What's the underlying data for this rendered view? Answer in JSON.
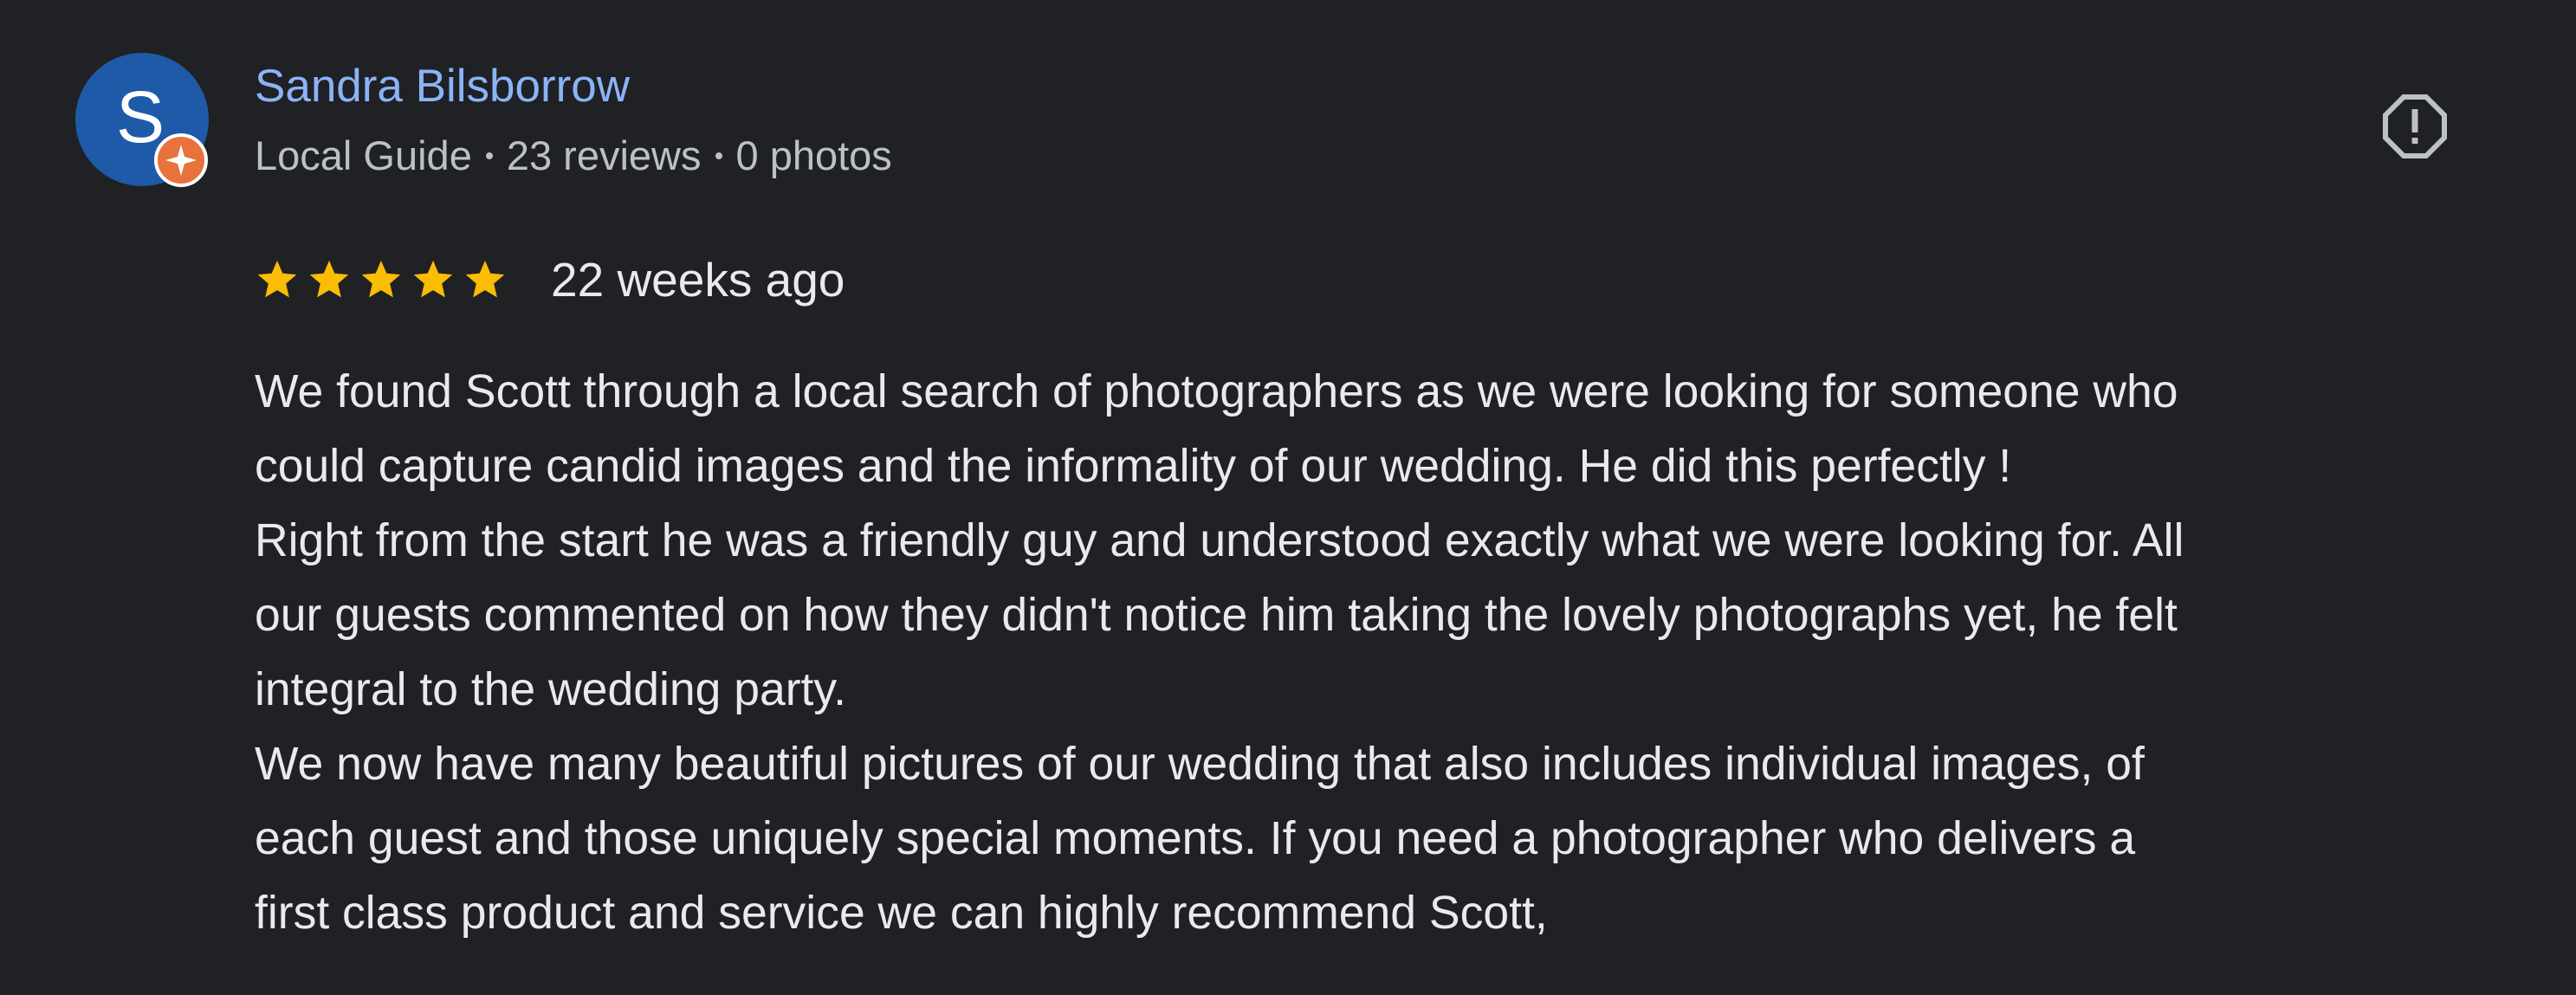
{
  "reviewer": {
    "initial": "S",
    "name": "Sandra Bilsborrow",
    "badge": "Local Guide",
    "reviews": "23 reviews",
    "photos": "0 photos"
  },
  "review": {
    "rating": 5,
    "rating_max": 5,
    "date": "22 weeks ago",
    "lines": [
      "We found Scott through a local search of photographers as we were looking for someone who",
      "could capture candid images and the informality of our wedding. He did this perfectly !",
      "Right from the start he was a friendly guy and understood exactly what we were looking for. All",
      "our guests commented on how they didn't notice him taking the lovely photographs yet, he felt",
      "integral to the wedding party.",
      "We now have many beautiful pictures of our wedding that also includes individual images, of",
      "each guest and those uniquely special moments. If you need a photographer who delivers a",
      "first class product and service we can highly recommend Scott,"
    ]
  },
  "icons": {
    "avatar_badge": "local-guide-badge-icon",
    "report": "report-icon",
    "star": "star-icon"
  },
  "colors": {
    "background": "#202124",
    "name": "#8ab4f8",
    "star": "#fbbc04",
    "avatar": "#1e5aa8",
    "badge": "#e8713c"
  }
}
